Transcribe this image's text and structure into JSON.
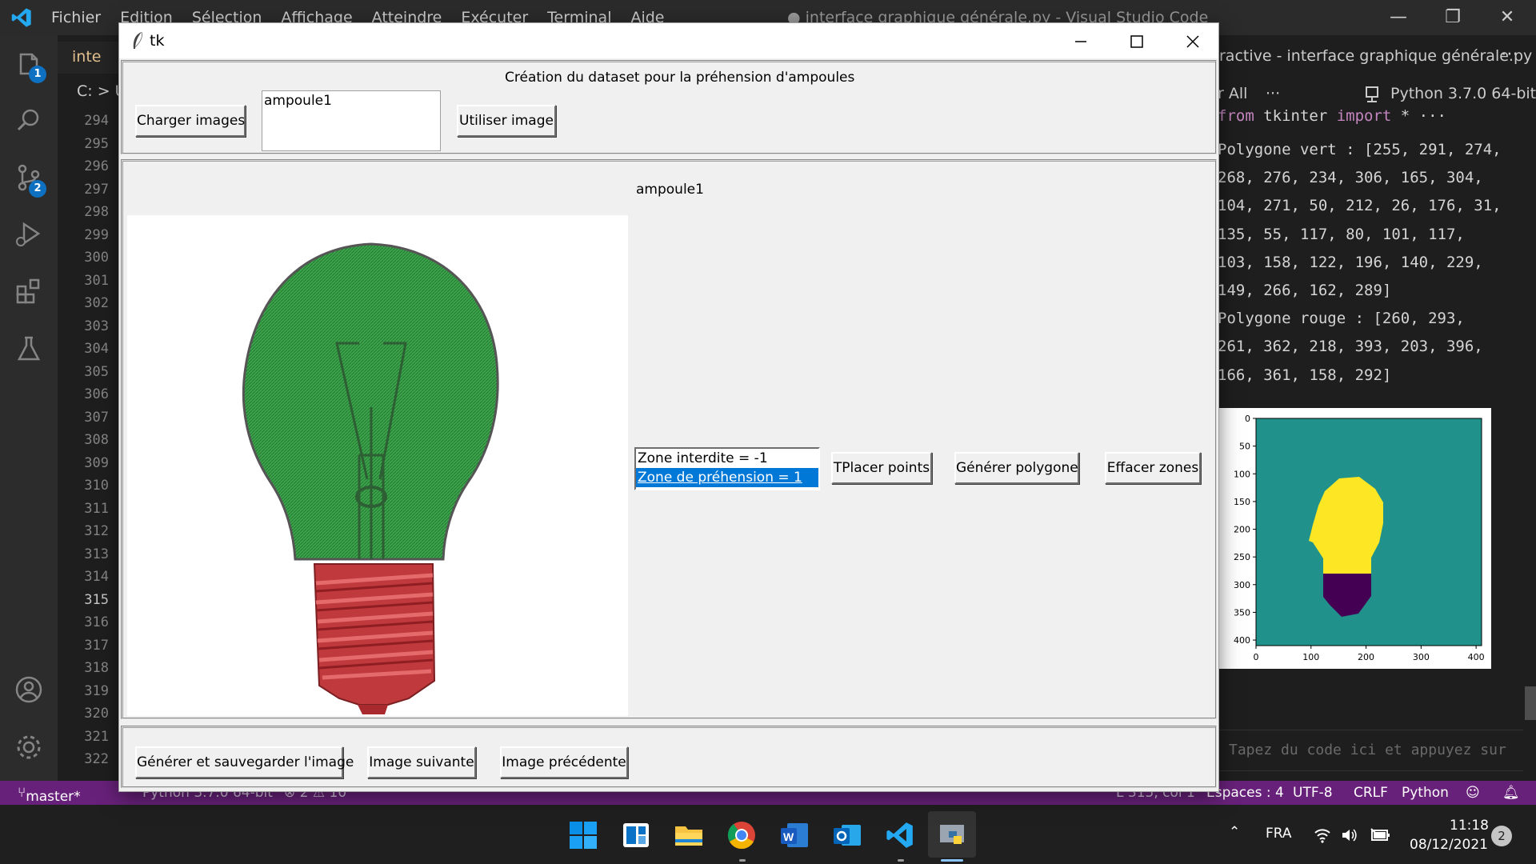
{
  "vscode": {
    "menu": [
      "Fichier",
      "Edition",
      "Sélection",
      "Affichage",
      "Atteindre",
      "Exécuter",
      "Terminal",
      "Aide"
    ],
    "window_title": "● interface graphique générale.py - Visual Studio Code",
    "tab_label": "inte",
    "breadcrumb": "C: > U",
    "line_numbers": [
      "294",
      "295",
      "296",
      "297",
      "298",
      "299",
      "300",
      "301",
      "302",
      "303",
      "304",
      "305",
      "306",
      "307",
      "308",
      "309",
      "310",
      "311",
      "312",
      "313",
      "314",
      "315",
      "316",
      "317",
      "318",
      "319",
      "320",
      "321",
      "322"
    ],
    "active_line": "315",
    "activity_badges": {
      "explorer": "1",
      "source_control": "2"
    },
    "interactive": {
      "title": "ractive - interface graphique générale.py",
      "run_all": "r All",
      "more": "···",
      "kernel": "Python 3.7.0 64-bit",
      "code_from": "from",
      "code_module": " tkinter ",
      "code_import": "import",
      "code_rest": " * ···",
      "output_lines": [
        "Polygone vert : [255, 291, 274,",
        "268, 276, 234, 306, 165, 304,",
        "104, 271, 50, 212, 26, 176, 31,",
        "135, 55, 117, 80, 101, 117,",
        "103, 158, 122, 196, 140, 229,",
        "149, 266, 162, 289]",
        "Polygone rouge : [260, 293,",
        "261, 362, 218, 393, 203, 396,",
        "166, 361, 158, 292]"
      ],
      "input_placeholder": "Tapez du code ici et appuyez sur"
    },
    "status": {
      "branch": "master*",
      "python": "Python 3.7.0 64-bit",
      "problems": "⊗ 2 ⚠ 10",
      "position": "L 315, col 1",
      "spaces": "Espaces : 4",
      "encoding": "UTF-8",
      "eol": "CRLF",
      "language": "Python"
    }
  },
  "plot": {
    "x_ticks": [
      "0",
      "100",
      "200",
      "300",
      "400"
    ],
    "y_ticks": [
      "0",
      "50",
      "100",
      "150",
      "200",
      "250",
      "300",
      "350",
      "400"
    ],
    "colors": {
      "background": "#21918c",
      "green_zone": "#fde725",
      "red_zone": "#440154"
    }
  },
  "tk": {
    "title": "tk",
    "header": "Création du dataset pour la préhension d'ampoules",
    "load_button": "Charger images",
    "entry_value": "ampoule1",
    "use_button": "Utiliser image",
    "image_name": "ampoule1",
    "listbox": [
      "Zone interdite = -1",
      "Zone de préhension = 1"
    ],
    "selected_index": 1,
    "place_points_button": "TPlacer points",
    "generate_polygon_button": "Générer polygone",
    "clear_button": "Effacer zones",
    "save_button": "Générer et sauvegarder l'image",
    "next_button": "Image suivante",
    "prev_button": "Image précédente"
  },
  "taskbar": {
    "lang": "FRA",
    "time": "11:18",
    "date": "08/12/2021",
    "notifications": "2"
  }
}
